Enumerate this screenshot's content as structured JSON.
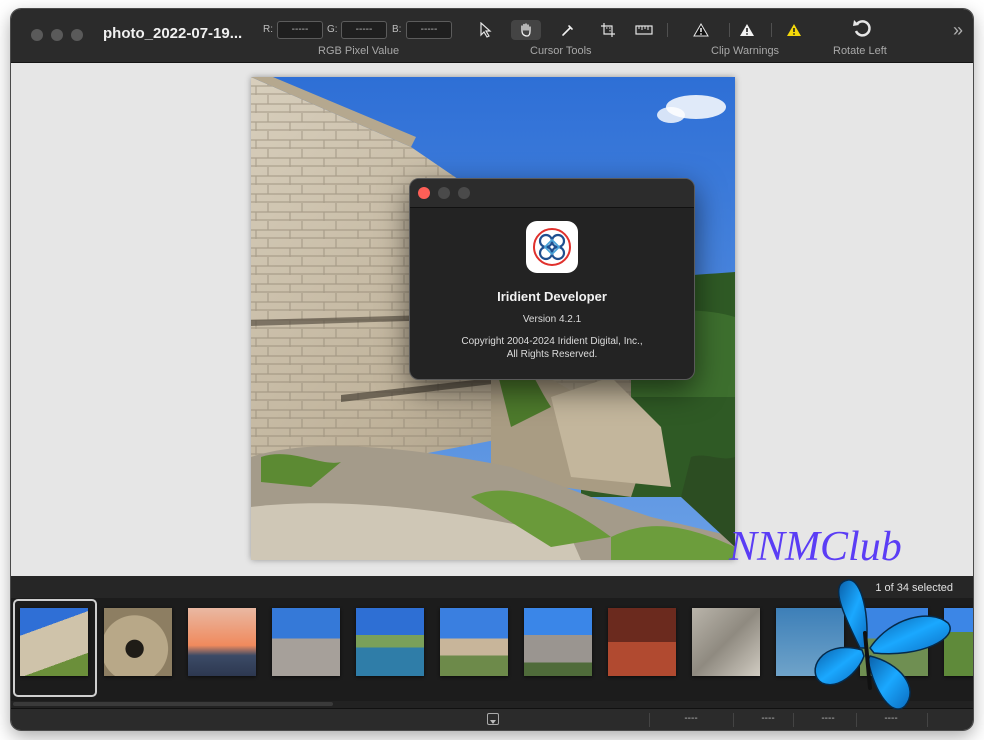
{
  "window": {
    "title": "photo_2022-07-19..."
  },
  "toolbar": {
    "rgb": {
      "r_label": "R:",
      "r_value": "-----",
      "g_label": "G:",
      "g_value": "-----",
      "b_label": "B:",
      "b_value": "-----",
      "group_label": "RGB Pixel Value"
    },
    "cursor_tools": {
      "group_label": "Cursor Tools",
      "tools": [
        "arrow-pointer-icon",
        "hand-icon",
        "eyedropper-icon",
        "crop-icon",
        "ruler-icon"
      ],
      "selected": "hand-icon"
    },
    "clip_warnings": {
      "group_label": "Clip Warnings"
    },
    "rotate": {
      "group_label": "Rotate Left"
    },
    "overflow_icon": "chevrons-right-icon"
  },
  "about_dialog": {
    "app_name": "Iridient Developer",
    "version": "Version 4.2.1",
    "copyright_line1": "Copyright 2004-2024 Iridient Digital, Inc.,",
    "copyright_line2": "All Rights Reserved."
  },
  "watermark": {
    "text": "NNMClub"
  },
  "filmstrip": {
    "selection_text": "1 of 34 selected",
    "thumbnails": [
      {
        "name": "fortress-wall",
        "selected": true
      },
      {
        "name": "cave-entrance",
        "selected": false
      },
      {
        "name": "sunset-sea",
        "selected": false
      },
      {
        "name": "cliff-lighthouse",
        "selected": false
      },
      {
        "name": "lake-town",
        "selected": false
      },
      {
        "name": "village-buildings",
        "selected": false
      },
      {
        "name": "mountain-peak",
        "selected": false
      },
      {
        "name": "palace-interior",
        "selected": false
      },
      {
        "name": "rocky-coast",
        "selected": false
      },
      {
        "name": "seagull-water",
        "selected": false
      },
      {
        "name": "coast-cliffs",
        "selected": false
      },
      {
        "name": "green-hillside",
        "selected": false
      }
    ]
  },
  "statusbar": {
    "values": [
      "----",
      "----",
      "----",
      "----"
    ]
  },
  "colors": {
    "toolbar_bg": "#2b2b2b",
    "viewer_bg": "#e6e6e6",
    "dialog_bg": "#232323",
    "close_red": "#fe5f57",
    "warning_yellow": "#f5d90a",
    "watermark_purple": "#5b3df5"
  }
}
